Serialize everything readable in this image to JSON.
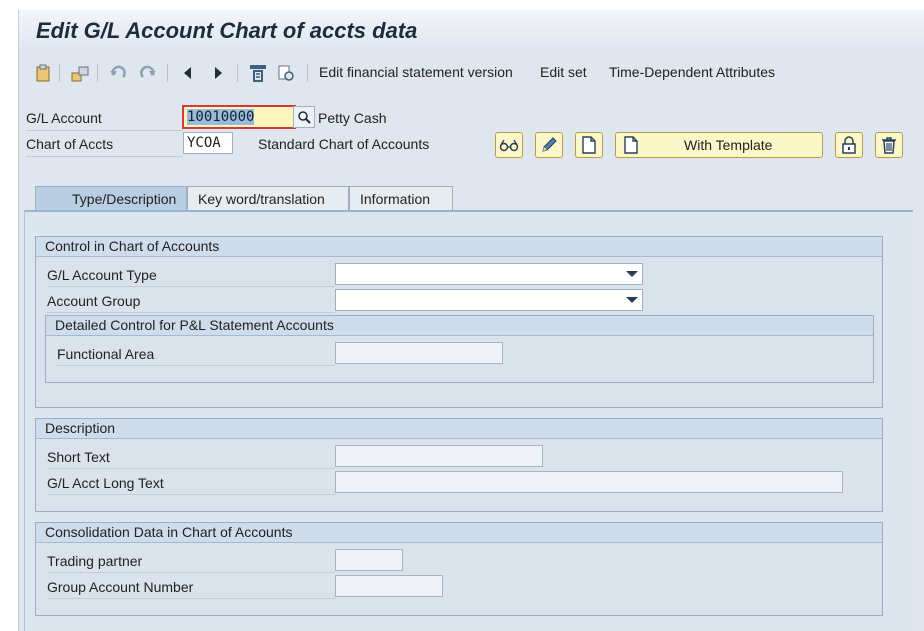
{
  "title": "Edit G/L Account Chart of accts data",
  "toolbar": {
    "icons": [
      "clipboard-icon",
      "transport-icon",
      "undo-icon",
      "redo-icon",
      "previous-icon",
      "next-icon",
      "hierarchy-icon",
      "where-used-icon"
    ],
    "edit_fs_version": "Edit financial statement version",
    "edit_set": "Edit set",
    "time_dependent": "Time-Dependent Attributes"
  },
  "header": {
    "gl_account_label": "G/L Account",
    "gl_account_value": "10010000",
    "gl_account_desc": "Petty Cash",
    "chart_label": "Chart of Accts",
    "chart_value": "YCOA",
    "chart_desc": "Standard Chart of Accounts",
    "with_template": "With Template"
  },
  "tabs": [
    {
      "label": "Type/Description",
      "active": true
    },
    {
      "label": "Key word/translation",
      "active": false
    },
    {
      "label": "Information",
      "active": false
    }
  ],
  "control": {
    "title": "Control in Chart of Accounts",
    "account_type_label": "G/L Account Type",
    "account_type_value": "",
    "account_group_label": "Account Group",
    "account_group_value": "",
    "pl_title": "Detailed Control for P&L Statement Accounts",
    "functional_area_label": "Functional Area",
    "functional_area_value": ""
  },
  "description": {
    "title": "Description",
    "short_text_label": "Short Text",
    "short_text_value": "",
    "long_text_label": "G/L Acct Long Text",
    "long_text_value": ""
  },
  "consolidation": {
    "title": "Consolidation Data in Chart of Accounts",
    "trading_partner_label": "Trading partner",
    "trading_partner_value": "",
    "group_account_label": "Group Account Number",
    "group_account_value": ""
  },
  "colors": {
    "button_fill": "#fcf7c8",
    "active_field": "#fef5bd",
    "tab_active": "#b9cde3",
    "panel": "#dde6ef"
  }
}
